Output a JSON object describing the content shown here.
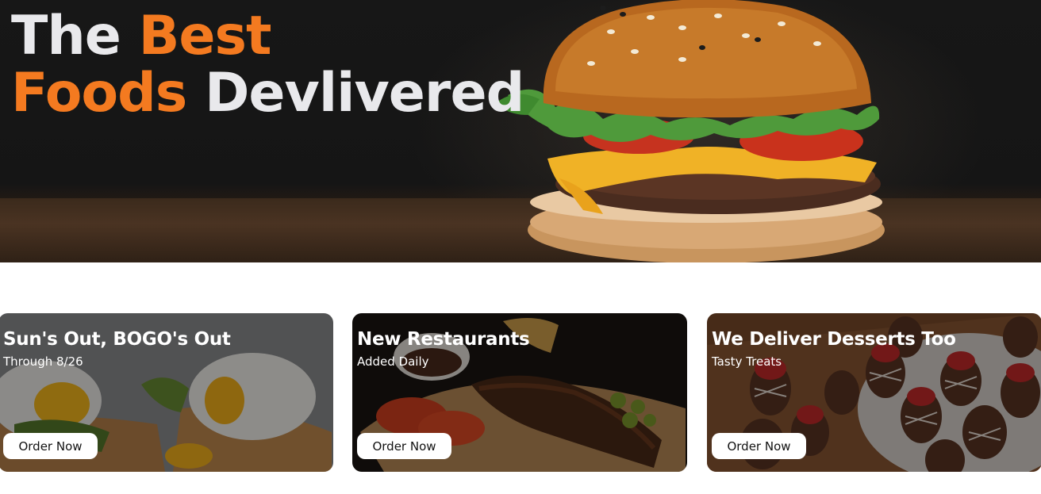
{
  "hero": {
    "title_part1": "The ",
    "title_accent1": "Best",
    "title_accent2": "Foods",
    "title_part2": " Devlivered",
    "accent_color": "#f47a20",
    "image": "burger-photo"
  },
  "cards": [
    {
      "title": "Sun's Out, BOGO's Out",
      "subtitle": "Through 8/26",
      "button": "Order Now",
      "image": "eggs-avocado-toast-photo"
    },
    {
      "title": "New Restaurants",
      "subtitle": "Added Daily",
      "button": "Order Now",
      "image": "ribs-platter-photo"
    },
    {
      "title": "We Deliver Desserts Too",
      "subtitle": "Tasty Treats",
      "button": "Order Now",
      "image": "chocolate-strawberries-photo"
    }
  ]
}
